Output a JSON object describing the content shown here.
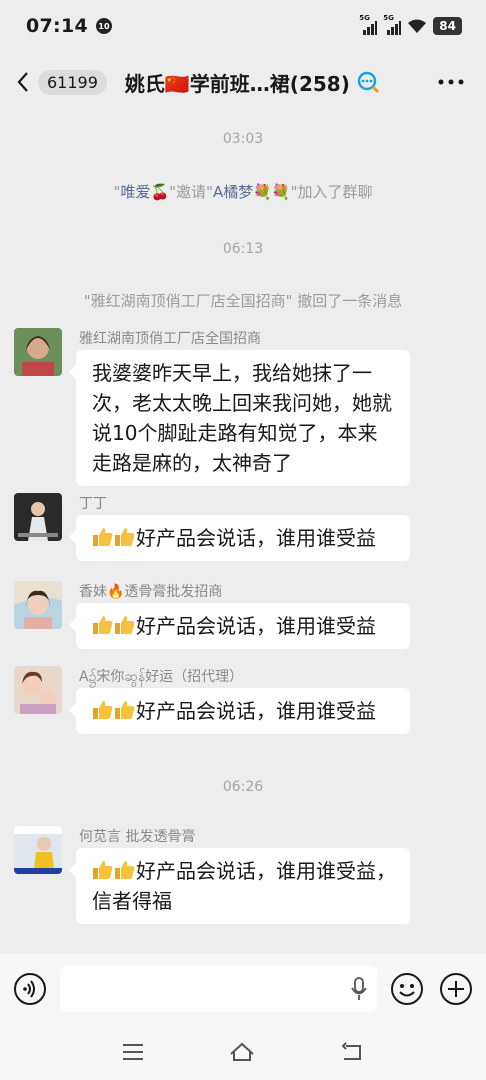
{
  "status_bar": {
    "time": "07:14",
    "notif_badge": "10",
    "signal1_label": "5G",
    "signal2_label": "5G",
    "battery": "84"
  },
  "header": {
    "unread_count": "61199",
    "title": "姚氏🇨🇳学前班…裙(258)"
  },
  "chat": {
    "time1": "03:03",
    "sys1": {
      "p1": "\"",
      "name1": "唯爱🍒",
      "p2": "\"邀请\"",
      "name2": "A橘梦💐💐",
      "p3": "\"加入了群聊"
    },
    "time2": "06:13",
    "sys2": "\"雅红湖南顶俏工厂店全国招商\" 撤回了一条消息",
    "messages": [
      {
        "sender": "雅红湖南顶俏工厂店全国招商",
        "text": "我婆婆昨天早上，我给她抹了一次，老太太晚上回来我问她，她就说10个脚趾走路有知觉了，本来走路是麻的，太神奇了"
      },
      {
        "sender": "丁丁",
        "text": "好产品会说话，谁用谁受益"
      },
      {
        "sender": "香妹🔥透骨膏批发招商",
        "text": "好产品会说话，谁用谁受益"
      },
      {
        "sender": "A၌宋你ဆွန်好运（招代理）",
        "text": "好产品会说话，谁用谁受益"
      },
      {
        "sender": "何苋言 批发透骨膏",
        "text": "好产品会说话，谁用谁受益，信者得福"
      }
    ],
    "time3": "06:26"
  },
  "colors": {
    "background": "#ededed",
    "bubble": "#ffffff",
    "link_blue": "#576b95",
    "time_gray": "#a6a6a6"
  }
}
